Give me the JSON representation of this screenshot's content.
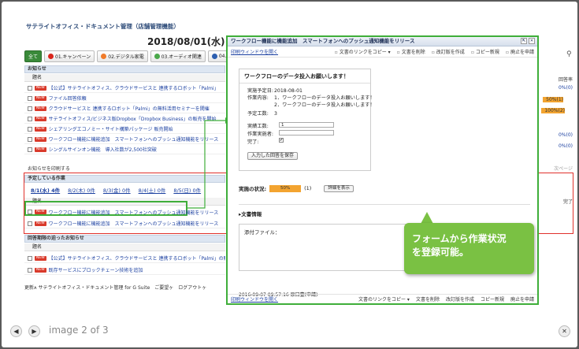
{
  "app": {
    "title": "サテライトオフィス・ドキュメント管理（店舗管理機能）",
    "date": "2018/08/01(水)"
  },
  "categories": [
    {
      "label": "全て",
      "color": ""
    },
    {
      "label": "01.キャンペーン",
      "color": "#d9261c"
    },
    {
      "label": "02.デジタル家電",
      "color": "#f07b2a"
    },
    {
      "label": "03.オーディオ関連",
      "color": "#4aa84a"
    },
    {
      "label": "04.",
      "color": "#2d5fb0"
    }
  ],
  "news": {
    "header": "お知らせ",
    "column": "題名",
    "items": [
      "【公式】サテライトオフィス、クラウドサービスと 連携するロボット「Palmi」",
      "ファイル回答依頼",
      "クラウドサービスと 連携するロボット「Palmi」の無料活用セミナーを開催",
      "サテライトオフィス/ビジネス版Dropbox「Dropbox Business」の販売を開始",
      "シェアリングエコノミー・サイト構築パッケージ 販売開始",
      "ワークフロー機能に機能追加　スマートフォンへのプッシュ通知機能をリリース",
      "シングルサインオン機能　導入社数が2,500社突破"
    ],
    "print_label": "お知らせを印刷する",
    "right_header": "回答率",
    "right_values": [
      "0%(0)",
      "",
      "50%(1)",
      "100%(2)",
      "",
      "0%(0)",
      "0%(0)"
    ],
    "next_page": "次ページ"
  },
  "scheduled": {
    "header": "予定している作業",
    "dates": [
      "8/1(水) 4件",
      "8/2(木) 0件",
      "8/3(金) 0件",
      "8/4(土) 0件",
      "8/5(日) 0件"
    ],
    "column": "題名",
    "items": [
      "ワークフロー機能に機能追加　スマートフォンへのプッシュ通知機能をリリース",
      "ワークフロー機能に機能追加　スマートフォンへのプッシュ通知機能をリリース"
    ],
    "done_header": "完了"
  },
  "overdue": {
    "header": "回答期限の迫ったお知らせ",
    "column": "題名",
    "items": [
      "【公式】サテライトオフィス、クラウドサービスと 連携するロボット「Palmi」の販",
      "既存サービスにブロックチェーン技術を追加"
    ]
  },
  "footer": "更新ᴀ サテライトオフィス・ドキュメント管理 for G Suite　ご要望ヶ　ログアウトヶ",
  "modal": {
    "title": "ワークフロー機能に機能追加　スマートフォンへのプッシュ通知機能をリリース",
    "open_window": "印刷ウィンドウを開く",
    "actions": [
      "文書のリンクをコピー ▾",
      "文書を削除",
      "改訂版を作成",
      "コピー新規",
      "廃止を申請"
    ],
    "form_heading": "ワークフローのデータ投入お願いします！",
    "planned_date_label": "実施予定日:",
    "planned_date": "2018-08-01",
    "task_label": "作業内容:",
    "task_lines": [
      "1．ワークフローのデータ投入お願いします！",
      "2．ワークフローのデータ投入お願いします！"
    ],
    "effort_label": "予定工数:",
    "effort": "3",
    "actual_effort_label": "実績工数:",
    "actual_effort": "1",
    "worker_label": "作業実施者:",
    "worker": "",
    "done_label": "完了:",
    "done_mark": "✔",
    "save_label": "入力した回答を保存",
    "status_label": "実施の状況:",
    "status_value": "50%",
    "status_count": "(1)",
    "status_progress": 0.5,
    "detail_label": "詳細を表示",
    "doc_info": "▸文書情報",
    "attach_label": "添付ファイル：",
    "log": "2016-09-07 09:57:16 原口壹(申請)"
  },
  "callout": {
    "lines": [
      "フォームから作業状況",
      "を登録可能。"
    ]
  },
  "nav": {
    "counter": "image 2 of 3",
    "prev": "◀",
    "next": "▶",
    "close": "✕"
  },
  "colors": {
    "highlight_green": "#3fae3a",
    "highlight_red": "#e0312c",
    "callout_green": "#7ac143"
  }
}
